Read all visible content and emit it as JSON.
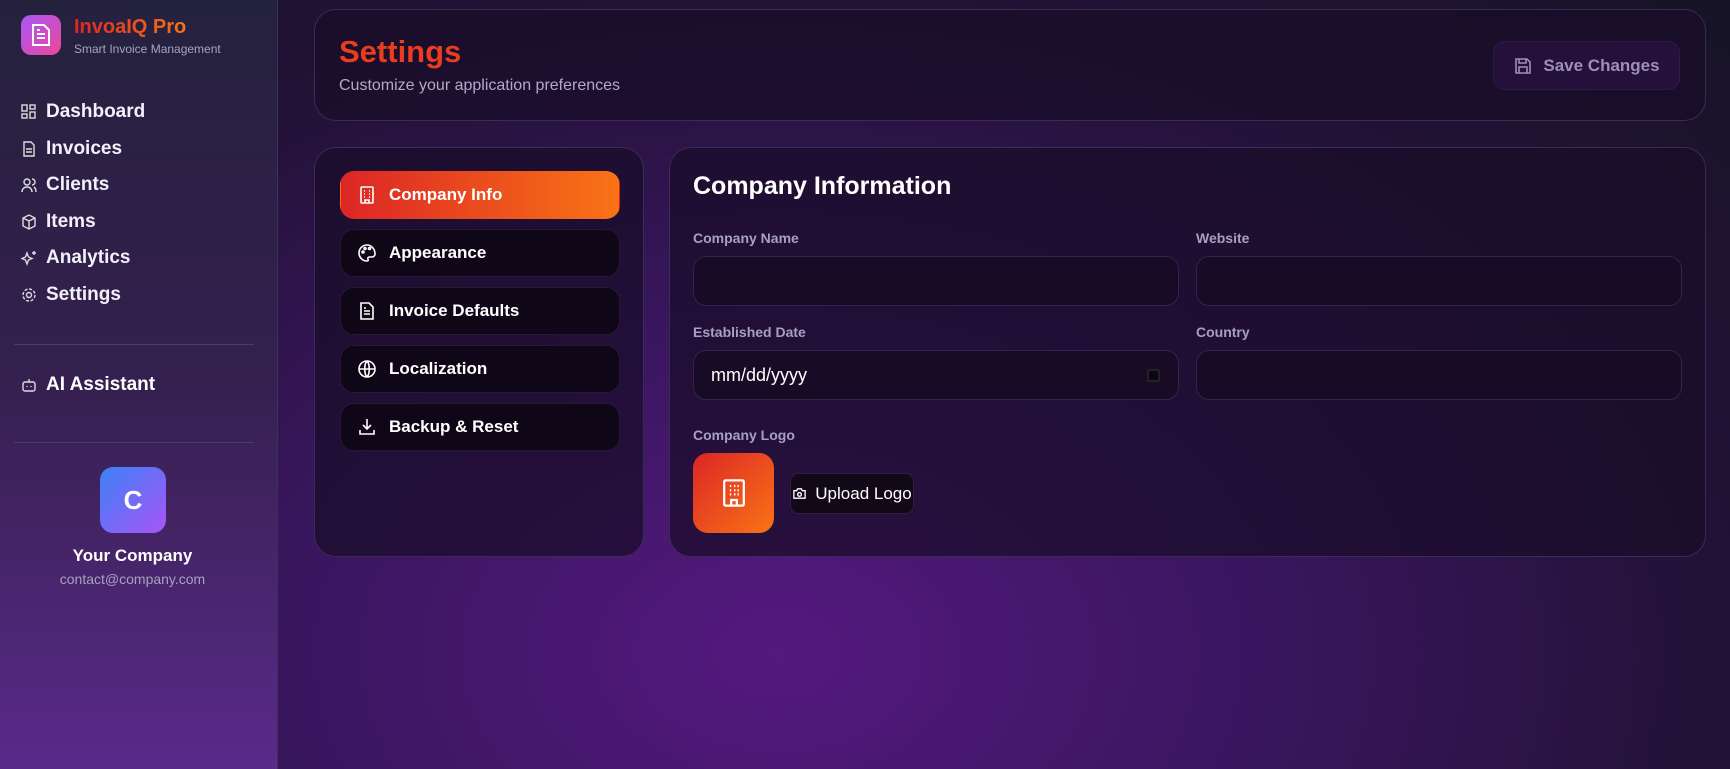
{
  "app": {
    "name": "InvoaIQ Pro",
    "tagline": "Smart Invoice Management"
  },
  "sidebar": {
    "items": [
      {
        "label": "Dashboard",
        "icon": "dashboard-icon"
      },
      {
        "label": "Invoices",
        "icon": "file-icon"
      },
      {
        "label": "Clients",
        "icon": "users-icon"
      },
      {
        "label": "Items",
        "icon": "box-icon"
      },
      {
        "label": "Analytics",
        "icon": "sparkles-icon"
      },
      {
        "label": "Settings",
        "icon": "gear-icon"
      }
    ],
    "ai_label": "AI Assistant",
    "company": {
      "initial": "C",
      "name": "Your Company",
      "email": "contact@company.com"
    }
  },
  "header": {
    "title": "Settings",
    "subtitle": "Customize your application preferences",
    "save_label": "Save Changes"
  },
  "tabs": [
    {
      "label": "Company Info",
      "active": true
    },
    {
      "label": "Appearance"
    },
    {
      "label": "Invoice Defaults"
    },
    {
      "label": "Localization"
    },
    {
      "label": "Backup & Reset"
    }
  ],
  "form": {
    "title": "Company Information",
    "company_name_label": "Company Name",
    "company_name_value": "",
    "website_label": "Website",
    "website_value": "",
    "date_label": "Established Date",
    "date_placeholder": "mm/dd/yyyy",
    "country_label": "Country",
    "country_value": "",
    "logo_label": "Company Logo",
    "upload_label": "Upload Logo"
  },
  "colors": {
    "accent_start": "#dc2626",
    "accent_end": "#f97316"
  }
}
